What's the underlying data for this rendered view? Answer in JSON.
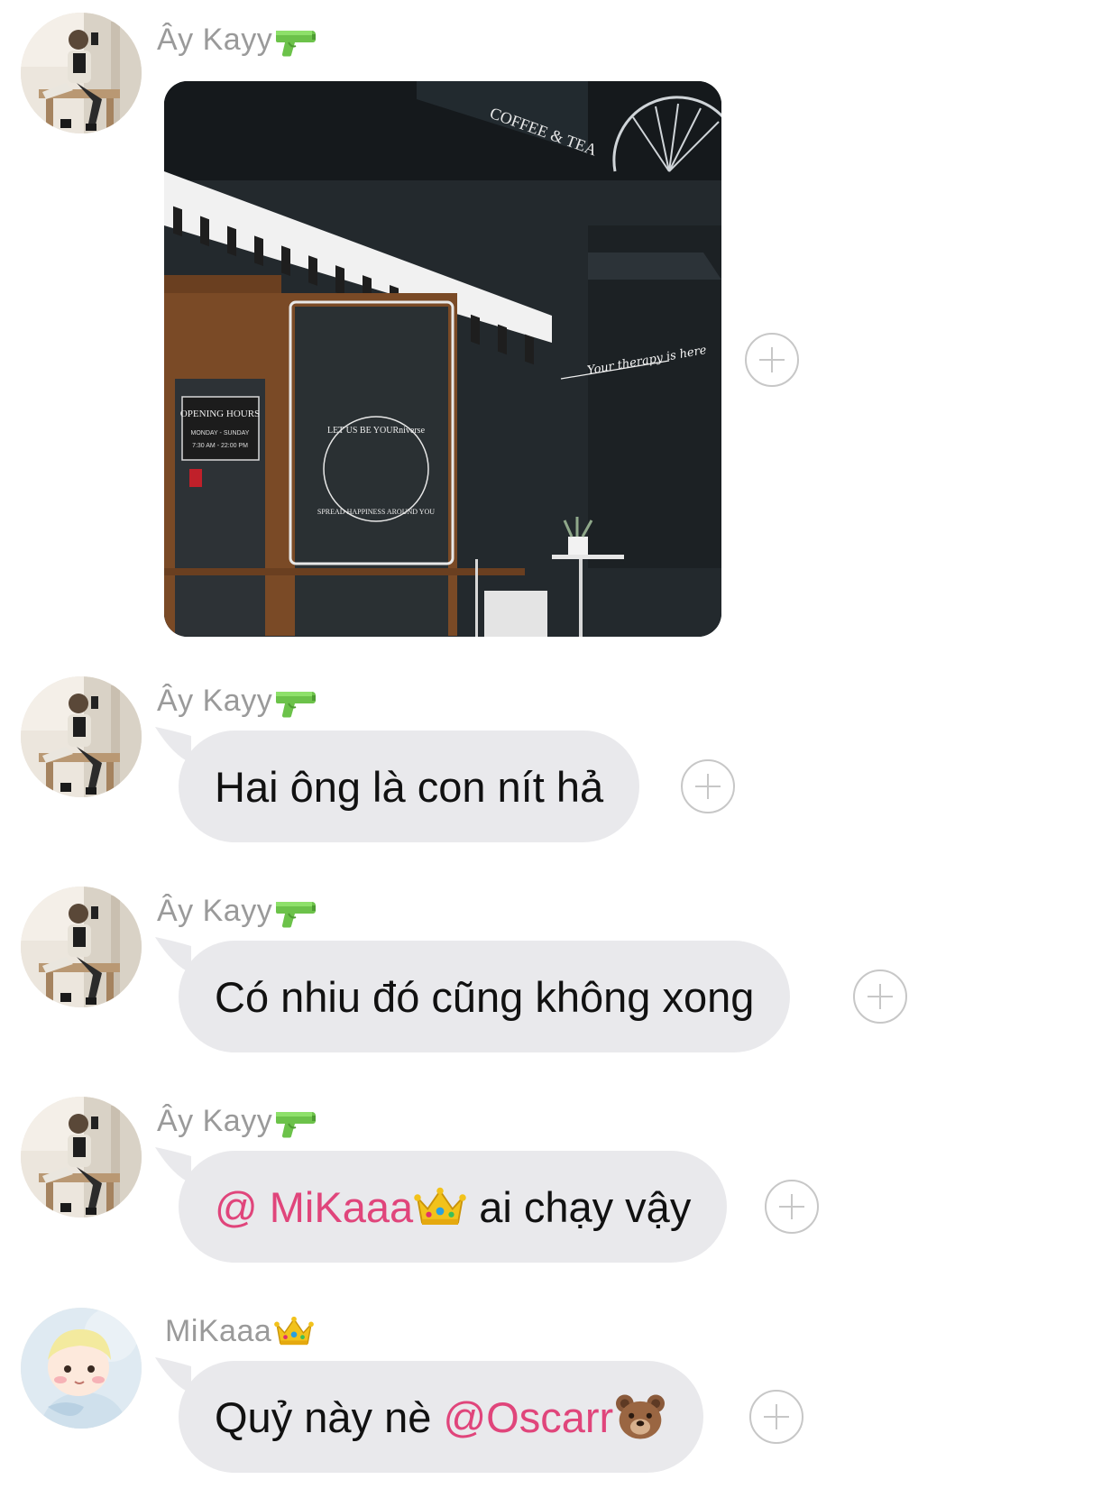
{
  "messages": [
    {
      "sender": "Ây Kayy",
      "sender_emoji": "water-pistol",
      "type": "image",
      "image_description": "storefront-photo",
      "image_text": [
        "COFFEE & TEA",
        "LET US BE YOURniverse",
        "SPREAD HAPPINESS AROUND YOU",
        "Your therapy is here",
        "OPENING HOURS",
        "MONDAY - SUNDAY",
        "7:30 AM - 22:00 PM"
      ]
    },
    {
      "sender": "Ây Kayy",
      "sender_emoji": "water-pistol",
      "type": "text",
      "text": "Hai ông là con nít hả"
    },
    {
      "sender": "Ây Kayy",
      "sender_emoji": "water-pistol",
      "type": "text",
      "text": "Có nhiu đó cũng không xong"
    },
    {
      "sender": "Ây Kayy",
      "sender_emoji": "water-pistol",
      "type": "text",
      "mention": "@ MiKaaa",
      "mention_emoji": "crown",
      "text": " ai chạy vậy"
    },
    {
      "sender": "MiKaaa",
      "sender_emoji": "crown",
      "type": "text",
      "text": "Quỷ này nè ",
      "mention": "@Oscarr",
      "mention_emoji": "bear-face"
    }
  ],
  "colors": {
    "bubble": "#e9e9ec",
    "mention": "#e0457b",
    "sender_name": "#9a9a9a",
    "react_icon": "#c7c7c7"
  },
  "icons": {
    "react": "add-reaction-icon"
  }
}
